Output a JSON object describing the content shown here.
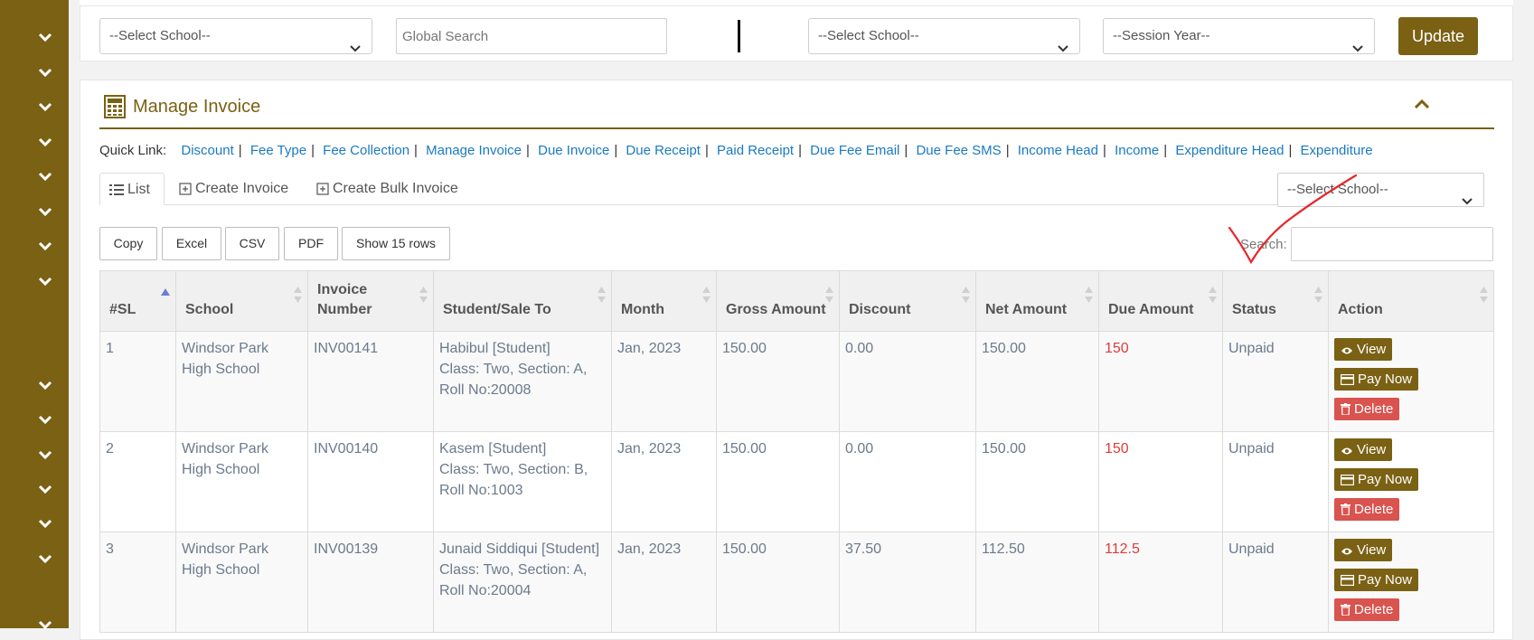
{
  "sidebar": {
    "chevron_count": 15
  },
  "topbar": {
    "school_select": "--Select School--",
    "global_search_placeholder": "Global Search",
    "school_select_2": "--Select School--",
    "session_year_select": "--Session Year--",
    "update_label": "Update"
  },
  "panel": {
    "title": "Manage Invoice",
    "quick_link_label": "Quick Link:",
    "quick_links": [
      "Discount",
      "Fee Type",
      "Fee Collection",
      "Manage Invoice",
      "Due Invoice",
      "Due Receipt",
      "Paid Receipt",
      "Due Fee Email",
      "Due Fee SMS",
      "Income Head",
      "Income",
      "Expenditure Head",
      "Expenditure"
    ],
    "tabs": {
      "list": "List",
      "create_invoice": "Create Invoice",
      "create_bulk_invoice": "Create Bulk Invoice"
    },
    "school_filter": "--Select School--"
  },
  "datatable": {
    "buttons": {
      "copy": "Copy",
      "excel": "Excel",
      "csv": "CSV",
      "pdf": "PDF",
      "show_rows": "Show 15 rows"
    },
    "search_label": "Search:",
    "columns": {
      "sl": "#SL",
      "school": "School",
      "invoice_number_1": "Invoice",
      "invoice_number_2": "Number",
      "student": "Student/Sale To",
      "month": "Month",
      "gross": "Gross Amount",
      "discount": "Discount",
      "net": "Net Amount",
      "due": "Due Amount",
      "status": "Status",
      "action": "Action"
    },
    "rows": [
      {
        "sl": "1",
        "school_1": "Windsor Park",
        "school_2": "High School",
        "invoice": "INV00141",
        "student_1": "Habibul [Student]",
        "student_2": "Class: Two, Section: A,",
        "student_3": "Roll No:20008",
        "month": "Jan, 2023",
        "gross": "150.00",
        "discount": "0.00",
        "net": "150.00",
        "due": "150",
        "status": "Unpaid"
      },
      {
        "sl": "2",
        "school_1": "Windsor Park",
        "school_2": "High School",
        "invoice": "INV00140",
        "student_1": "Kasem [Student]",
        "student_2": "Class: Two, Section: B,",
        "student_3": "Roll No:1003",
        "month": "Jan, 2023",
        "gross": "150.00",
        "discount": "0.00",
        "net": "150.00",
        "due": "150",
        "status": "Unpaid"
      },
      {
        "sl": "3",
        "school_1": "Windsor Park",
        "school_2": "High School",
        "invoice": "INV00139",
        "student_1": "Junaid Siddiqui [Student]",
        "student_2": "Class: Two, Section: A,",
        "student_3": "Roll No:20004",
        "month": "Jan, 2023",
        "gross": "150.00",
        "discount": "37.50",
        "net": "112.50",
        "due": "112.5",
        "status": "Unpaid"
      }
    ],
    "actions": {
      "view": "View",
      "pay_now": "Pay Now",
      "delete": "Delete"
    }
  },
  "colors": {
    "brand": "#7a6114",
    "link": "#1a7ac0",
    "due": "#e03a3a",
    "delete": "#d9534f"
  },
  "icons": [
    "chevron-down-icon",
    "calculator-icon",
    "chevron-up-icon",
    "list-icon",
    "plus-square-icon",
    "sort-icon",
    "eye-icon",
    "credit-card-icon",
    "trash-icon"
  ]
}
